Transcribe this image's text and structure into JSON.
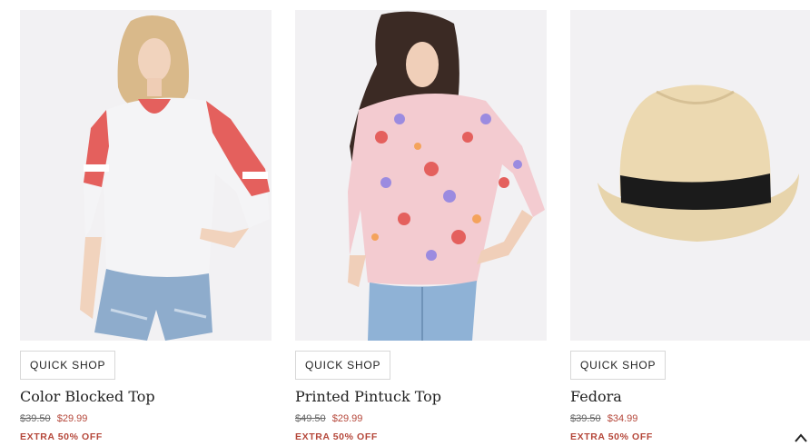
{
  "products": [
    {
      "name": "Color Blocked Top",
      "old_price": "$39.50",
      "sale_price": "$29.99",
      "promo": "EXTRA 50% OFF",
      "quick_shop": "QUICK SHOP"
    },
    {
      "name": "Printed Pintuck Top",
      "old_price": "$49.50",
      "sale_price": "$29.99",
      "promo": "EXTRA 50% OFF",
      "quick_shop": "QUICK SHOP"
    },
    {
      "name": "Fedora",
      "old_price": "$39.50",
      "sale_price": "$34.99",
      "promo": "EXTRA 50% OFF",
      "quick_shop": "QUICK SHOP"
    }
  ],
  "icons": {
    "scroll_top": "chevron-up-icon"
  },
  "colors": {
    "sale": "#b5473a",
    "accent_coral": "#e4605d"
  }
}
